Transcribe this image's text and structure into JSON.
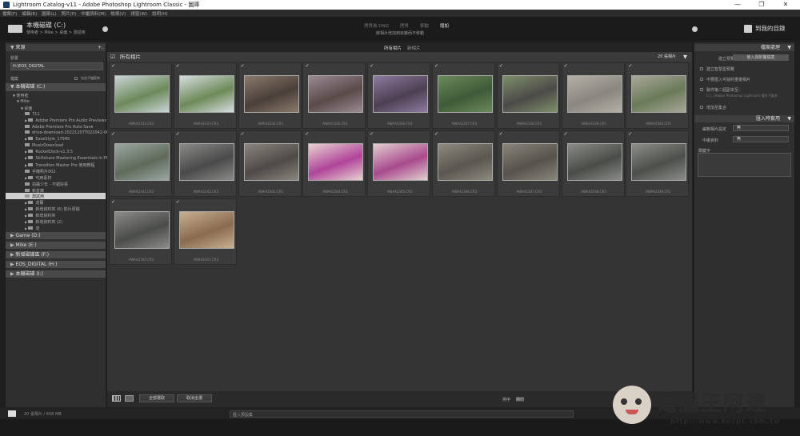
{
  "window": {
    "title": "Lightroom Catalog-v11 - Adobe Photoshop Lightroom Classic - 圖庫",
    "min": "—",
    "max": "❐",
    "close": "✕"
  },
  "menu": [
    "檔案(F)",
    "編輯(E)",
    "圖庫(L)",
    "照片(P)",
    "中繼資料(M)",
    "檢視(V)",
    "視窗(W)",
    "說明(H)"
  ],
  "identity": {
    "source": "本機磁碟 (C:)",
    "source_sub": "使用者 > Mike > 桌面 > 測試用",
    "modes": [
      "拷貝為 DNG",
      "拷貝",
      "移動",
      "增加"
    ],
    "mode_active": "增加",
    "mode_desc": "將相片增加到目錄而不移動",
    "dest": "到我的目錄"
  },
  "left": {
    "header": "來源",
    "section_device": "裝置",
    "device": "H:\\EOS_DIGITAL",
    "files_label": "檔案",
    "include_sub": "包含子檔案夾",
    "drive_c": "本機磁碟 (C:)",
    "tree": [
      {
        "label": "使用者",
        "indent": 1,
        "arrow": "▼"
      },
      {
        "label": "Mike",
        "indent": 2,
        "arrow": "▼"
      },
      {
        "label": "桌面",
        "indent": 3,
        "arrow": "▼"
      },
      {
        "label": "711",
        "indent": 4,
        "arrow": ""
      },
      {
        "label": "Adobe Premiere Pro Audio Previews",
        "indent": 4,
        "arrow": "▶"
      },
      {
        "label": "Adobe Premiere Pro Auto-Save",
        "indent": 4,
        "arrow": ""
      },
      {
        "label": "drive-download-20221207T022042-001",
        "indent": 4,
        "arrow": ""
      },
      {
        "label": "EaseStyle_17945",
        "indent": 4,
        "arrow": "▶"
      },
      {
        "label": "MusicDownload",
        "indent": 4,
        "arrow": ""
      },
      {
        "label": "RocketDock-v1.3.5",
        "indent": 4,
        "arrow": "▶"
      },
      {
        "label": "Skillshare-Mastering Essentials in PR A must lea...",
        "indent": 4,
        "arrow": "▶"
      },
      {
        "label": "Transition Master Pro 使用教程",
        "indent": 4,
        "arrow": "▶"
      },
      {
        "label": "手機照片002",
        "indent": 4,
        "arrow": ""
      },
      {
        "label": "可用素材",
        "indent": 4,
        "arrow": "▶"
      },
      {
        "label": "拍攝少年 - 不錯好看",
        "indent": 4,
        "arrow": ""
      },
      {
        "label": "新倉庫",
        "indent": 4,
        "arrow": ""
      },
      {
        "label": "測試用",
        "indent": 4,
        "arrow": "",
        "selected": true
      },
      {
        "label": "達爾",
        "indent": 4,
        "arrow": "▶"
      },
      {
        "label": "新增資料夾 (6) 影片原檔",
        "indent": 4,
        "arrow": "▶"
      },
      {
        "label": "新增資料夾",
        "indent": 4,
        "arrow": "▶"
      },
      {
        "label": "新增資料夾 (2)",
        "indent": 4,
        "arrow": "▶"
      },
      {
        "label": "達",
        "indent": 4,
        "arrow": "▶"
      }
    ],
    "drives": [
      "Game (D:)",
      "Mike (E:)",
      "新增磁碟區 (F:)",
      "EOS_DIGITAL (H:)",
      "本機磁碟 (I:)"
    ]
  },
  "center": {
    "tabs": [
      "所有相片",
      "新相片"
    ],
    "grid_title": "所有相片",
    "count": "20 張相片",
    "toolbar": {
      "check_all": "全部選取",
      "uncheck_all": "取消全選",
      "sort_label": "排序",
      "sort_value": "關閉"
    }
  },
  "photos": [
    {
      "file": "AWAA2332.CR3",
      "c1": "#6d8a5a",
      "c2": "#c9d4d7"
    },
    {
      "file": "AWAA2333.CR3",
      "c1": "#6e8a58",
      "c2": "#d5dde0"
    },
    {
      "file": "AWAA2334.CR3",
      "c1": "#4a3f3a",
      "c2": "#8a7a6a"
    },
    {
      "file": "AWAA2335.CR3",
      "c1": "#5a4a48",
      "c2": "#9a8a95"
    },
    {
      "file": "AWAA2336.CR3",
      "c1": "#4d3f52",
      "c2": "#8e7aa0"
    },
    {
      "file": "AWAA2337.CR3",
      "c1": "#3f5a38",
      "c2": "#6a8a5a"
    },
    {
      "file": "AWAA2338.CR3",
      "c1": "#4c4a48",
      "c2": "#7d8f6a"
    },
    {
      "file": "AWAA2339.CR3",
      "c1": "#8a8680",
      "c2": "#b5b0a5"
    },
    {
      "file": "AWAA2340.CR3",
      "c1": "#6a7a58",
      "c2": "#a8a898"
    },
    {
      "file": "AWAA2341.CR3",
      "c1": "#5f6a5a",
      "c2": "#9aa8a2"
    },
    {
      "file": "AWAA2342.CR3",
      "c1": "#4a4a4a",
      "c2": "#8a8a88"
    },
    {
      "file": "AWAA2343.CR3",
      "c1": "#4f4a46",
      "c2": "#8a857e"
    },
    {
      "file": "AWAA2344.CR3",
      "c1": "#b0449a",
      "c2": "#e8d2d0"
    },
    {
      "file": "AWAA2345.CR3",
      "c1": "#a84a8e",
      "c2": "#e3cfcf"
    },
    {
      "file": "AWAA2346.CR3",
      "c1": "#5a5650",
      "c2": "#8e8a7e"
    },
    {
      "file": "AWAA2347.CR3",
      "c1": "#56524c",
      "c2": "#8a857a"
    },
    {
      "file": "AWAA2348.CR3",
      "c1": "#4a4c48",
      "c2": "#8a8c88"
    },
    {
      "file": "AWAA2349.CR3",
      "c1": "#4c4f4a",
      "c2": "#8c8e88"
    },
    {
      "file": "AWAA2350.CR3",
      "c1": "#4a4c4a",
      "c2": "#8c8c8a"
    },
    {
      "file": "AWAA2351.CR3",
      "c1": "#8a6a50",
      "c2": "#c8b090"
    }
  ],
  "right": {
    "file_handling": "檔案處理",
    "build_previews_label": "建立預覽",
    "build_previews_value": "嵌入與附屬檔案",
    "opt1": "建立智慧型預覽",
    "opt2": "不要匯入可疑的重複相片",
    "opt3": "製作第二個副本至：",
    "opt3_path": "C:\\...\\Adobe Photoshop Lightroom 備份下載項",
    "opt4": "增加至集合",
    "apply_during": "匯入時套用",
    "develop_label": "編輯相片設定",
    "develop_value": "無",
    "metadata_label": "中繼資料",
    "metadata_value": "無",
    "keywords_label": "關鍵字"
  },
  "filmstrip": {
    "info": "20 張相片 / 658 MB",
    "input_placeholder": "匯入預設集"
  },
  "watermark": {
    "text": "電腦王阿達",
    "url": "http://www.kocpc.com.tw"
  }
}
